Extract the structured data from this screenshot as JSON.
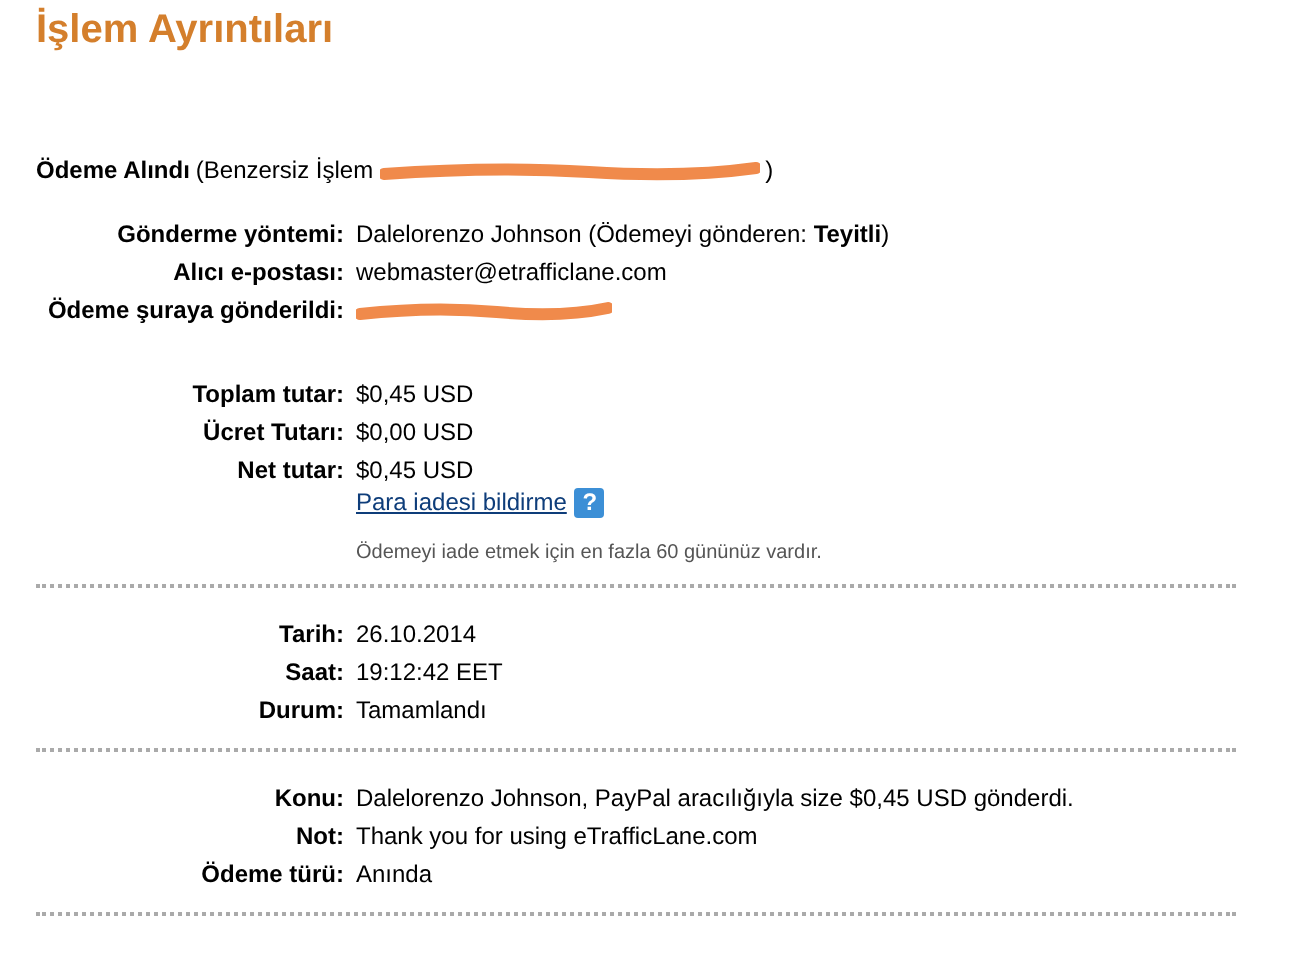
{
  "title": "İşlem Ayrıntıları",
  "payment_received": {
    "label": "Ödeme Alındı",
    "detail_start": "(Benzersiz İşlem",
    "redacted": true,
    "detail_end": ")"
  },
  "sections": [
    {
      "rows": [
        {
          "label": "Gönderme yöntemi:",
          "value": "Dalelorenzo Johnson (Ödemeyi gönderen: **Teyitli**)"
        },
        {
          "label": "Alıcı e-postası:",
          "value": "webmaster@etrafficlane.com"
        },
        {
          "label": "Ödeme şuraya gönderildi:",
          "redacted": true
        }
      ]
    },
    {
      "rows": [
        {
          "label": "Toplam tutar:",
          "value": "$0,45 USD"
        },
        {
          "label": "Ücret Tutarı:",
          "value": "$0,00 USD"
        },
        {
          "label": "Net tutar:",
          "value": "$0,45 USD"
        }
      ],
      "link": "Para iadesi bildirme",
      "help_icon": "?",
      "note": "Ödemeyi iade etmek için en fazla 60 gününüz vardır.",
      "divider_after": true
    },
    {
      "rows": [
        {
          "label": "Tarih:",
          "value": "26.10.2014"
        },
        {
          "label": "Saat:",
          "value": "19:12:42 EET"
        },
        {
          "label": "Durum:",
          "value": "Tamamlandı"
        }
      ],
      "divider_after": true
    },
    {
      "rows": [
        {
          "label": "Konu:",
          "value": "Dalelorenzo Johnson, PayPal aracılığıyla size $0,45 USD gönderdi."
        },
        {
          "label": "Not:",
          "value": "Thank you for using eTrafficLane.com"
        },
        {
          "label": "Ödeme türü:",
          "value": "Anında"
        }
      ],
      "divider_after": true
    }
  ]
}
